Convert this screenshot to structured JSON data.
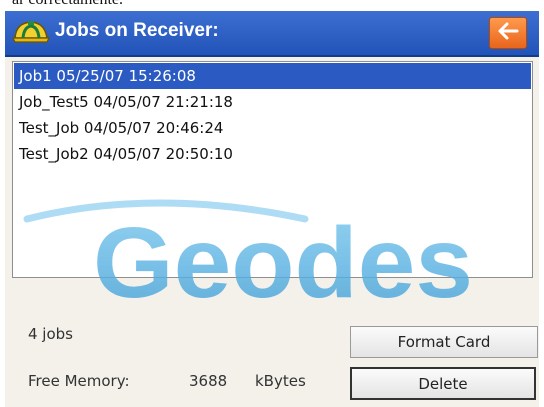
{
  "caption": "ar correctamente.",
  "header": {
    "title": "Jobs on Receiver:",
    "back_icon": "back-arrow-icon",
    "app_icon": "survey-helmet-icon"
  },
  "jobs": [
    {
      "label": "Job1 05/25/07 15:26:08",
      "selected": true
    },
    {
      "label": "Job_Test5 04/05/07 21:21:18",
      "selected": false
    },
    {
      "label": "Test_Job 04/05/07 20:46:24",
      "selected": false
    },
    {
      "label": "Test_Job2 04/05/07 20:50:10",
      "selected": false
    }
  ],
  "footer": {
    "count_text": "4 jobs",
    "memory_label": "Free Memory:",
    "memory_value": "3688",
    "memory_unit": "kBytes"
  },
  "buttons": {
    "format_label": "Format Card",
    "delete_label": "Delete"
  },
  "watermark_text": "Geodes",
  "colors": {
    "titlebar": "#2b5bc2",
    "selection": "#2b5bc2",
    "back_button": "#f07a30",
    "watermark": "#5ab4e6"
  }
}
